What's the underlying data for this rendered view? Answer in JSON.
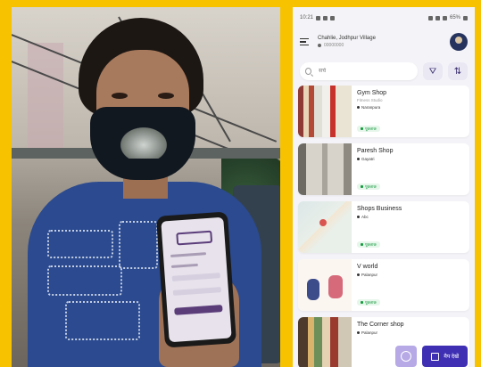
{
  "statusbar": {
    "time": "10:21",
    "battery": "65%"
  },
  "header": {
    "location_title": "Chahlie, Jodhpur Village",
    "location_sub": "00000000"
  },
  "search": {
    "placeholder": "सर्च"
  },
  "shops": [
    {
      "name": "Gym Shop",
      "meta": "Fitness Studio",
      "location": "Naranpura",
      "badge": "पूछताछ"
    },
    {
      "name": "Paresh Shop",
      "meta": "",
      "location": "Gayatri",
      "badge": "पूछताछ"
    },
    {
      "name": "Shops Business",
      "meta": "",
      "location": "Abc",
      "badge": "पूछताछ"
    },
    {
      "name": "V world",
      "meta": "",
      "location": "Palanpur",
      "badge": "पूछताछ"
    },
    {
      "name": "The Corner shop",
      "meta": "",
      "location": "Palanpur",
      "badge": ""
    }
  ],
  "fab": {
    "map_label": "मैप देखें"
  },
  "icons": {
    "menu": "menu-icon",
    "filter": "filter-icon",
    "sort": "sort-icon",
    "location": "location-pin-icon",
    "call": "phone-icon",
    "power": "power-icon",
    "map": "map-icon"
  },
  "colors": {
    "frame": "#f7c300",
    "accent": "#3f2fb3",
    "badge_text": "#1a9b43"
  }
}
